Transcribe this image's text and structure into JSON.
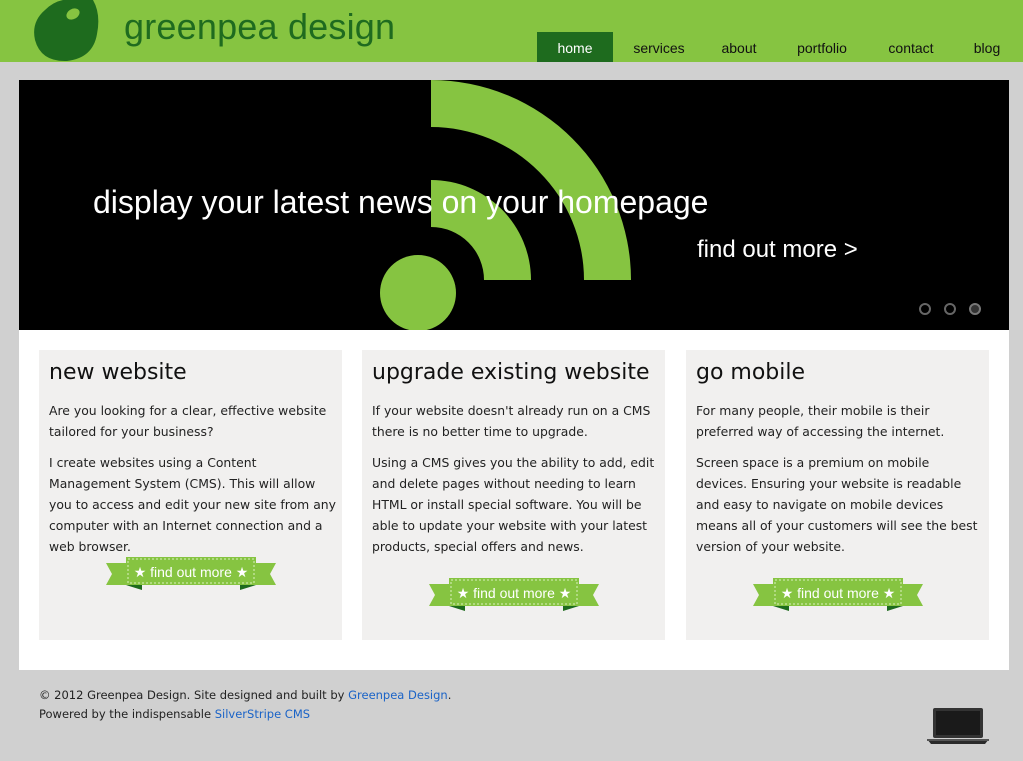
{
  "header": {
    "brand": "greenpea design",
    "nav": [
      {
        "label": "home",
        "active": true
      },
      {
        "label": "services",
        "active": false
      },
      {
        "label": "about",
        "active": false
      },
      {
        "label": "portfolio",
        "active": false
      },
      {
        "label": "contact",
        "active": false
      },
      {
        "label": "blog",
        "active": false
      }
    ]
  },
  "hero": {
    "headline": "display your latest news on your homepage",
    "link": "find out more >",
    "slides_total": 3,
    "active_slide": 3
  },
  "cards": [
    {
      "title": "new website",
      "paragraphs": [
        "Are you looking for a clear, effective website tailored for your business?",
        "I create websites using a Content Management System (CMS). This will allow you to access and edit your new site from any computer with an Internet connection and a web browser."
      ],
      "button": "find out more"
    },
    {
      "title": "upgrade existing website",
      "paragraphs": [
        "If your website doesn't already run on a CMS there is no better time to upgrade.",
        "Using a CMS gives you the ability to add, edit and delete pages without needing to learn HTML or install special software. You will be able to update your website with your latest products, special offers and news."
      ],
      "button": "find out more"
    },
    {
      "title": "go mobile",
      "paragraphs": [
        "For many people, their mobile is their preferred way of accessing the internet.",
        "Screen space is a premium on mobile devices. Ensuring your website is readable and easy to navigate on mobile devices means all of your customers will see the best version of your website."
      ],
      "button": "find out more"
    }
  ],
  "footer": {
    "line1_prefix": "© 2012 Greenpea Design. Site designed and built by ",
    "line1_link": "Greenpea Design",
    "line1_suffix": ".",
    "line2_prefix": "Powered by the indispensable ",
    "line2_link": "SilverStripe CMS"
  },
  "colors": {
    "brand_green": "#86c441",
    "dark_green": "#1e6b1e",
    "link_blue": "#1a63c7"
  }
}
